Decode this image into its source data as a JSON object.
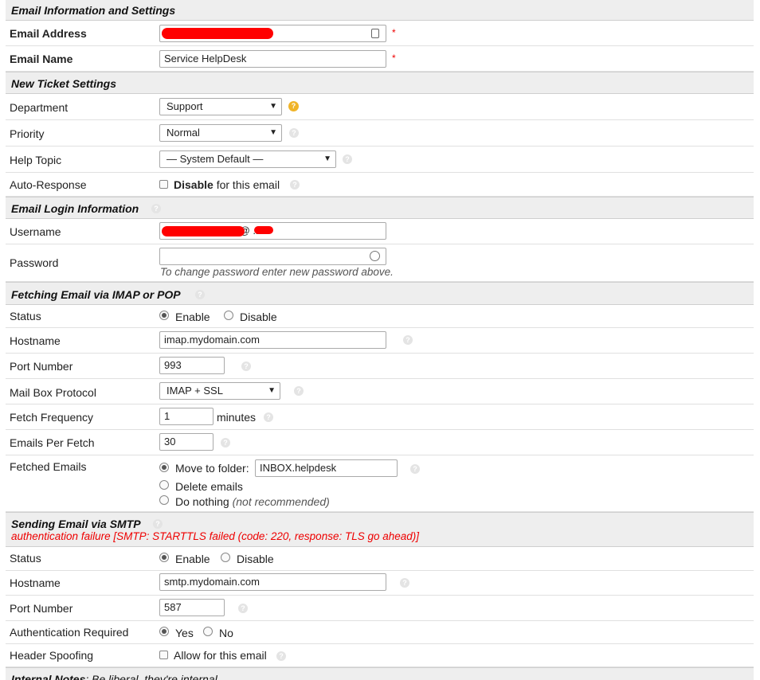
{
  "sections": {
    "email_info": "Email Information and Settings",
    "new_ticket": "New Ticket Settings",
    "login": "Email Login Information",
    "fetching": "Fetching Email via IMAP or POP",
    "sending": "Sending Email via SMTP",
    "sending_error": "authentication failure [SMTP: STARTTLS failed (code: 220, response: TLS go ahead)]",
    "internal_notes": "Internal Notes",
    "internal_notes_hint": ": Be liberal, they're internal"
  },
  "email_info": {
    "address_label": "Email Address",
    "address_value": "",
    "name_label": "Email Name",
    "name_value": "Service HelpDesk",
    "required_mark": "*"
  },
  "new_ticket": {
    "department_label": "Department",
    "department_value": "Support",
    "priority_label": "Priority",
    "priority_value": "Normal",
    "help_topic_label": "Help Topic",
    "help_topic_value": "— System Default —",
    "auto_response_label": "Auto-Response",
    "auto_response_bold": "Disable",
    "auto_response_rest": "for this email"
  },
  "login": {
    "username_label": "Username",
    "username_value": "t@      .biz",
    "password_label": "Password",
    "password_value": "",
    "password_hint": "To change password enter new password above."
  },
  "fetching": {
    "status_label": "Status",
    "enable": "Enable",
    "disable": "Disable",
    "hostname_label": "Hostname",
    "hostname_value": "imap.mydomain.com",
    "port_label": "Port Number",
    "port_value": "993",
    "protocol_label": "Mail Box Protocol",
    "protocol_value": "IMAP + SSL",
    "frequency_label": "Fetch Frequency",
    "frequency_value": "1",
    "frequency_unit": "minutes",
    "per_fetch_label": "Emails Per Fetch",
    "per_fetch_value": "30",
    "fetched_label": "Fetched Emails",
    "move_label": "Move to folder:",
    "folder_value": "INBOX.helpdesk",
    "delete_label": "Delete emails",
    "nothing_label": "Do nothing",
    "nothing_hint": "(not recommended)"
  },
  "sending": {
    "status_label": "Status",
    "enable": "Enable",
    "disable": "Disable",
    "hostname_label": "Hostname",
    "hostname_value": "smtp.mydomain.com",
    "port_label": "Port Number",
    "port_value": "587",
    "auth_label": "Authentication Required",
    "yes": "Yes",
    "no": "No",
    "spoof_label": "Header Spoofing",
    "spoof_text": "Allow for this email"
  },
  "icons": {
    "help": "question-circle-icon",
    "dropdown": "chevron-down-icon"
  },
  "colors": {
    "header_bg": "#eeeeee",
    "required": "#ee0000",
    "help_gold": "#f0b429"
  }
}
